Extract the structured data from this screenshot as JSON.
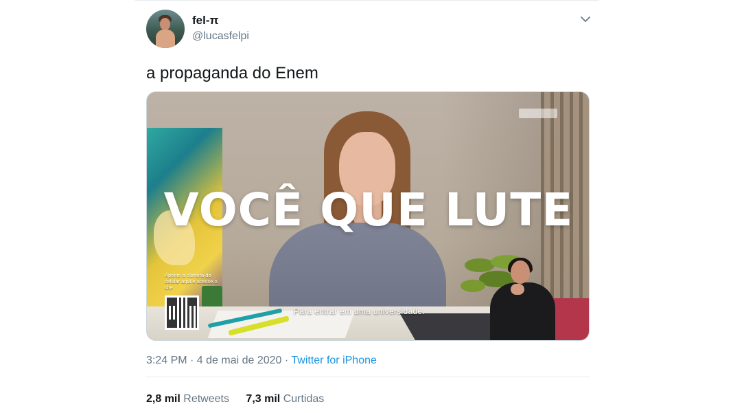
{
  "tweet": {
    "display_name": "fel-π",
    "handle": "@lucasfelpi",
    "text": "a propaganda do Enem",
    "timestamp": "3:24 PM · 4 de mai de 2020",
    "separator": " · ",
    "source": "Twitter for iPhone",
    "menu_icon": "chevron-down-icon"
  },
  "media": {
    "overlay_title": "VOCÊ QUE LUTE",
    "subtitle": "Para entrar em uma universidade.",
    "qr_note": "Aponte a câmera do celular aqui e acesse o site"
  },
  "stats": {
    "retweets_count": "2,8 mil",
    "retweets_label": "Retweets",
    "likes_count": "7,3 mil",
    "likes_label": "Curtidas"
  },
  "colors": {
    "text_primary": "#14171a",
    "text_secondary": "#657786",
    "link": "#1b95e0",
    "divider": "#e6ecf0"
  }
}
